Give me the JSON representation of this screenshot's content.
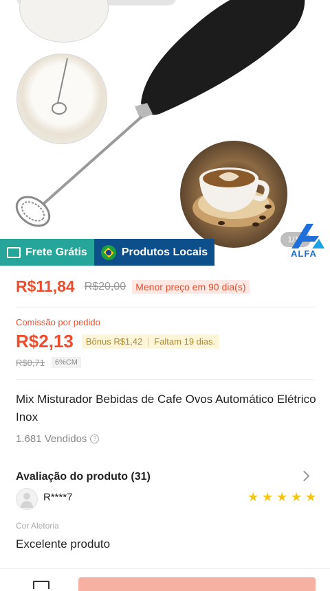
{
  "gallery": {
    "page_counter": "1/10",
    "logo_text": "ALFA"
  },
  "badges": {
    "shipping_label": "Frete Grátis",
    "local_label": "Produtos Locais"
  },
  "price": {
    "current": "R$11,84",
    "original": "R$20,00",
    "lowest_tag": "Menor preço em 90 dia(s)"
  },
  "commission": {
    "label": "Comissão por pedido",
    "amount": "R$2,13",
    "bonus": "Bônus R$1,42",
    "remaining": "Faltam 19 dias.",
    "old_amount": "R$0,71",
    "cm_tag": "6%CM"
  },
  "product": {
    "title": "Mix Misturador Bebidas de Cafe Ovos Automático Elétrico Inox",
    "sold": "1.681 Vendidos"
  },
  "reviews": {
    "title": "Avaliação do produto (31)",
    "items": [
      {
        "reviewer": "R****7",
        "rating": 5,
        "variant": "Cor Aletoria",
        "comment": "Excelente produto"
      }
    ]
  },
  "colors": {
    "accent": "#ee4d2d",
    "shipping_badge": "#26a69a",
    "local_badge": "#0d4f8b",
    "star": "#f5c518"
  }
}
